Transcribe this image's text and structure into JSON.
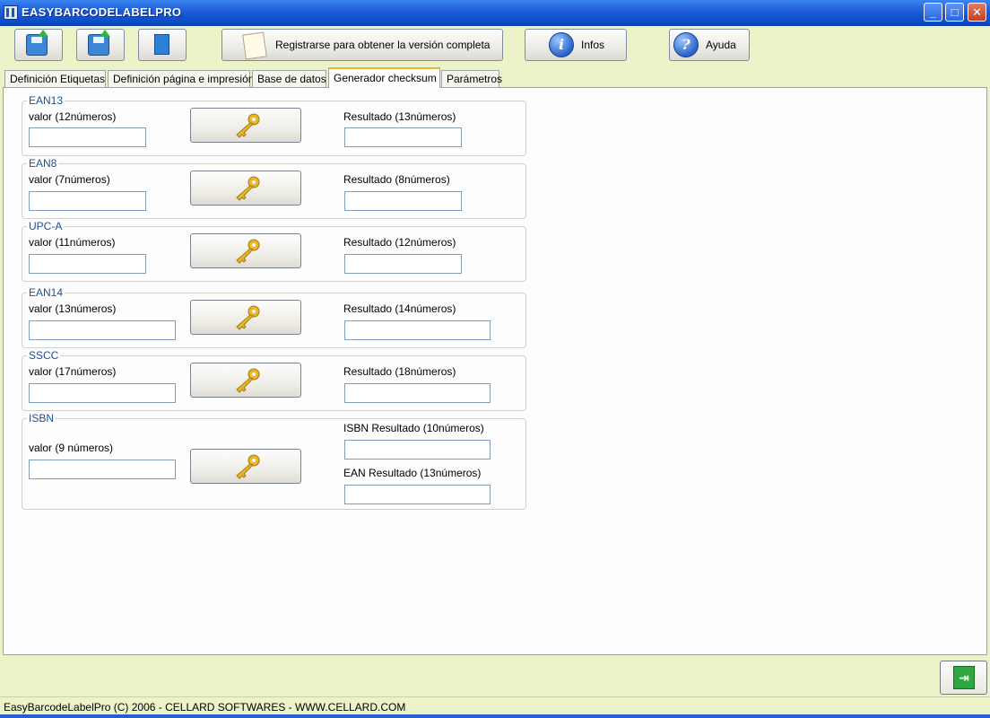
{
  "window": {
    "title": "EASYBARCODELABELPRO",
    "controls": [
      "_",
      "□",
      "✕"
    ]
  },
  "toolbar": {
    "register_label": "Registrarse para obtener la versión completa",
    "infos_label": "Infos",
    "ayuda_label": "Ayuda"
  },
  "tabs": [
    {
      "label": "Definición Etiquetas"
    },
    {
      "label": "Definición página e impresión"
    },
    {
      "label": "Base de datos"
    },
    {
      "label": "Generador checksum",
      "active": true
    },
    {
      "label": "Parámetros"
    }
  ],
  "groups": [
    {
      "title": "EAN13",
      "input_label": "valor (12números)",
      "input_value": "",
      "result_label": "Resultado (13números)",
      "result_value": ""
    },
    {
      "title": "EAN8",
      "input_label": "valor (7números)",
      "input_value": "",
      "result_label": "Resultado (8números)",
      "result_value": ""
    },
    {
      "title": "UPC-A",
      "input_label": "valor (11números)",
      "input_value": "",
      "result_label": "Resultado (12números)",
      "result_value": ""
    },
    {
      "title": "EAN14",
      "input_label": "valor (13números)",
      "input_value": "",
      "result_label": "Resultado (14números)",
      "result_value": ""
    },
    {
      "title": "SSCC",
      "input_label": "valor (17números)",
      "input_value": "",
      "result_label": "Resultado (18números)",
      "result_value": ""
    },
    {
      "title": "ISBN",
      "input_label": "valor (9 números)",
      "input_value": "",
      "result_label": "ISBN Resultado (10números)",
      "result_value": "",
      "result2_label": "EAN Resultado (13números)",
      "result2_value": ""
    }
  ],
  "status": {
    "text": "EasyBarcodeLabelPro (C) 2006 - CELLARD SOFTWARES - WWW.CELLARD.COM"
  },
  "icons": {
    "save": "save-icon",
    "save_as": "save-as-icon",
    "new": "new-document-icon",
    "register": "register-note-icon",
    "infos": "info-icon",
    "ayuda": "help-icon",
    "key": "key-icon",
    "exit": "exit-icon"
  },
  "colors": {
    "titlebar": "#0a4bc8",
    "background": "#ecf3c8",
    "group_title": "#1f4f9a",
    "active_tab_accent": "#f2b03b"
  }
}
